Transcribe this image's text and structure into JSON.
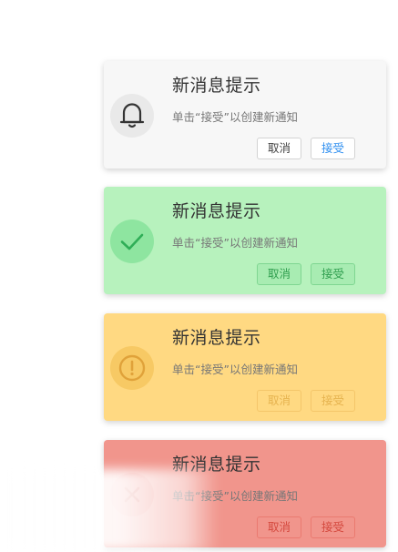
{
  "notifications": [
    {
      "variant": "default",
      "icon": "bell-icon",
      "title": "新消息提示",
      "message": "单击“接受”以创建新通知",
      "cancel_label": "取消",
      "accept_label": "接受",
      "accent": "#f7f7f7"
    },
    {
      "variant": "success",
      "icon": "check-icon",
      "title": "新消息提示",
      "message": "单击“接受”以创建新通知",
      "cancel_label": "取消",
      "accept_label": "接受",
      "accent": "#b7f2bd"
    },
    {
      "variant": "warning",
      "icon": "exclamation-icon",
      "title": "新消息提示",
      "message": "单击“接受”以创建新通知",
      "cancel_label": "取消",
      "accept_label": "接受",
      "accent": "#ffd982"
    },
    {
      "variant": "danger",
      "icon": "error-icon",
      "title": "新消息提示",
      "message": "单击“接受”以创建新通知",
      "cancel_label": "取消",
      "accept_label": "接受",
      "accent": "#f1958c"
    }
  ]
}
